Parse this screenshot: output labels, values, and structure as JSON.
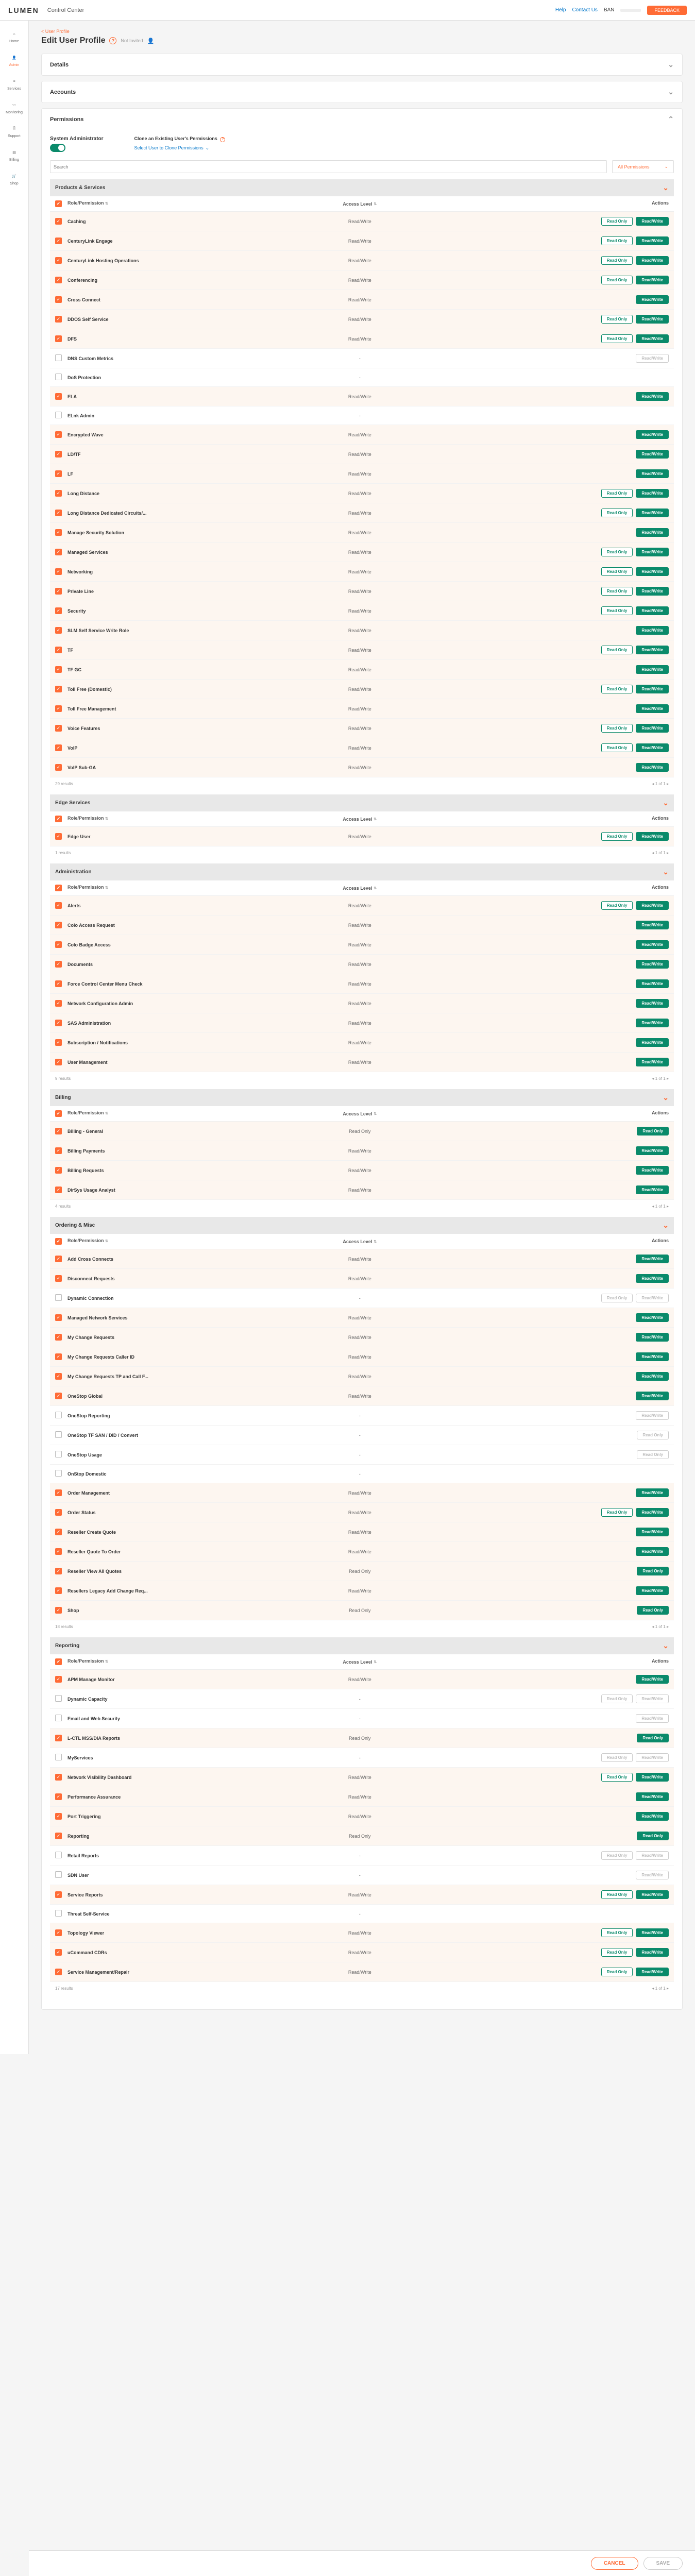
{
  "topbar": {
    "logo": "LUMEN",
    "product": "Control Center",
    "help": "Help",
    "contact": "Contact Us",
    "ban": "BAN",
    "feedback": "FEEDBACK"
  },
  "sidebar": {
    "items": [
      {
        "label": "Home",
        "icon": "⌂"
      },
      {
        "label": "Admin",
        "icon": "👤",
        "active": true
      },
      {
        "label": "Services",
        "icon": "≡"
      },
      {
        "label": "Monitoring",
        "icon": "〰"
      },
      {
        "label": "Support",
        "icon": "🗎"
      },
      {
        "label": "Billing",
        "icon": "▤"
      },
      {
        "label": "Shop",
        "icon": "🛒"
      }
    ]
  },
  "page": {
    "breadcrumb": "< User Profile",
    "title": "Edit User Profile",
    "title_sub": "Not Invited"
  },
  "panels": {
    "details": "Details",
    "accounts": "Accounts",
    "permissions": "Permissions"
  },
  "sysadmin": {
    "label": "System Administrator",
    "clone_title": "Clone an Existing User's Permissions",
    "clone_select": "Select User to Clone Permissions"
  },
  "filters": {
    "search_ph": "Search",
    "perm_sel": "All Permissions"
  },
  "headers": {
    "role": "Role/Permission",
    "level": "Access Level",
    "actions": "Actions"
  },
  "buttons": {
    "ro": "Read Only",
    "rw": "Read/Write",
    "cancel": "CANCEL",
    "save": "SAVE",
    "results": "results",
    "page": "1 of 1"
  },
  "sections": [
    {
      "title": "Products & Services",
      "count": "29 results",
      "rows": [
        {
          "name": "Caching",
          "chk": true,
          "lvl": "Read/Write",
          "ro": true,
          "rw": true,
          "rw_active": true
        },
        {
          "name": "CenturyLink Engage",
          "chk": true,
          "lvl": "Read/Write",
          "ro": true,
          "rw": true,
          "rw_active": true
        },
        {
          "name": "CenturyLink Hosting Operations",
          "chk": true,
          "lvl": "Read/Write",
          "ro": true,
          "rw": true,
          "rw_active": true
        },
        {
          "name": "Conferencing",
          "chk": true,
          "lvl": "Read/Write",
          "ro": true,
          "rw": true,
          "rw_active": true
        },
        {
          "name": "Cross Connect",
          "chk": true,
          "lvl": "Read/Write",
          "rw": true,
          "rw_active": true
        },
        {
          "name": "DDOS Self Service",
          "chk": true,
          "lvl": "Read/Write",
          "ro": true,
          "rw": true,
          "rw_active": true
        },
        {
          "name": "DFS",
          "chk": true,
          "lvl": "Read/Write",
          "ro": true,
          "rw": true,
          "rw_active": true
        },
        {
          "name": "DNS Custom Metrics",
          "chk": false,
          "lvl": "-",
          "rw": true,
          "rw_disabled": true
        },
        {
          "name": "DoS Protection",
          "chk": false,
          "lvl": "-"
        },
        {
          "name": "ELA",
          "chk": true,
          "lvl": "Read/Write",
          "rw": true,
          "rw_active": true
        },
        {
          "name": "ELnk Admin",
          "chk": false,
          "lvl": "-"
        },
        {
          "name": "Encrypted Wave",
          "chk": true,
          "lvl": "Read/Write",
          "rw": true,
          "rw_active": true
        },
        {
          "name": "LD/TF",
          "chk": true,
          "lvl": "Read/Write",
          "rw": true,
          "rw_active": true
        },
        {
          "name": "LF",
          "chk": true,
          "lvl": "Read/Write",
          "rw": true,
          "rw_active": true
        },
        {
          "name": "Long Distance",
          "chk": true,
          "lvl": "Read/Write",
          "ro": true,
          "rw": true,
          "rw_active": true
        },
        {
          "name": "Long Distance Dedicated Circuits/...",
          "chk": true,
          "lvl": "Read/Write",
          "ro": true,
          "rw": true,
          "rw_active": true
        },
        {
          "name": "Manage Security Solution",
          "chk": true,
          "lvl": "Read/Write",
          "rw": true,
          "rw_active": true
        },
        {
          "name": "Managed Services",
          "chk": true,
          "lvl": "Read/Write",
          "ro": true,
          "rw": true,
          "rw_active": true
        },
        {
          "name": "Networking",
          "chk": true,
          "lvl": "Read/Write",
          "ro": true,
          "rw": true,
          "rw_active": true
        },
        {
          "name": "Private Line",
          "chk": true,
          "lvl": "Read/Write",
          "ro": true,
          "rw": true,
          "rw_active": true
        },
        {
          "name": "Security",
          "chk": true,
          "lvl": "Read/Write",
          "ro": true,
          "rw": true,
          "rw_active": true
        },
        {
          "name": "SLM Self Service Write Role",
          "chk": true,
          "lvl": "Read/Write",
          "rw": true,
          "rw_active": true
        },
        {
          "name": "TF",
          "chk": true,
          "lvl": "Read/Write",
          "ro": true,
          "rw": true,
          "rw_active": true
        },
        {
          "name": "TF GC",
          "chk": true,
          "lvl": "Read/Write",
          "rw": true,
          "rw_active": true
        },
        {
          "name": "Toll Free (Domestic)",
          "chk": true,
          "lvl": "Read/Write",
          "ro": true,
          "rw": true,
          "rw_active": true
        },
        {
          "name": "Toll Free Management",
          "chk": true,
          "lvl": "Read/Write",
          "rw": true,
          "rw_active": true
        },
        {
          "name": "Voice Features",
          "chk": true,
          "lvl": "Read/Write",
          "ro": true,
          "rw": true,
          "rw_active": true
        },
        {
          "name": "VoIP",
          "chk": true,
          "lvl": "Read/Write",
          "ro": true,
          "rw": true,
          "rw_active": true
        },
        {
          "name": "VoIP Sub-GA",
          "chk": true,
          "lvl": "Read/Write",
          "rw": true,
          "rw_active": true
        }
      ]
    },
    {
      "title": "Edge Services",
      "count": "1 results",
      "rows": [
        {
          "name": "Edge User",
          "chk": true,
          "lvl": "Read/Write",
          "ro": true,
          "rw": true,
          "rw_active": true
        }
      ]
    },
    {
      "title": "Administration",
      "count": "9 results",
      "rows": [
        {
          "name": "Alerts",
          "chk": true,
          "lvl": "Read/Write",
          "ro": true,
          "rw": true,
          "rw_active": true
        },
        {
          "name": "Colo Access Request",
          "chk": true,
          "lvl": "Read/Write",
          "rw": true,
          "rw_active": true
        },
        {
          "name": "Colo Badge Access",
          "chk": true,
          "lvl": "Read/Write",
          "rw": true,
          "rw_active": true
        },
        {
          "name": "Documents",
          "chk": true,
          "lvl": "Read/Write",
          "rw": true,
          "rw_active": true
        },
        {
          "name": "Force Control Center Menu Check",
          "chk": true,
          "lvl": "Read/Write",
          "rw": true,
          "rw_active": true
        },
        {
          "name": "Network Configuration Admin",
          "chk": true,
          "lvl": "Read/Write",
          "rw": true,
          "rw_active": true
        },
        {
          "name": "SAS Administration",
          "chk": true,
          "lvl": "Read/Write",
          "rw": true,
          "rw_active": true
        },
        {
          "name": "Subscription / Notifications",
          "chk": true,
          "lvl": "Read/Write",
          "rw": true,
          "rw_active": true
        },
        {
          "name": "User Management",
          "chk": true,
          "lvl": "Read/Write",
          "rw": true,
          "rw_active": true
        }
      ]
    },
    {
      "title": "Billing",
      "count": "4 results",
      "rows": [
        {
          "name": "Billing - General",
          "chk": true,
          "lvl": "Read Only",
          "ro": true,
          "ro_active": true
        },
        {
          "name": "Billing Payments",
          "chk": true,
          "lvl": "Read/Write",
          "rw": true,
          "rw_active": true
        },
        {
          "name": "Billing Requests",
          "chk": true,
          "lvl": "Read/Write",
          "rw": true,
          "rw_active": true
        },
        {
          "name": "DirSys Usage Analyst",
          "chk": true,
          "lvl": "Read/Write",
          "rw": true,
          "rw_active": true
        }
      ]
    },
    {
      "title": "Ordering & Misc",
      "count": "18 results",
      "rows": [
        {
          "name": "Add Cross Connects",
          "chk": true,
          "lvl": "Read/Write",
          "rw": true,
          "rw_active": true
        },
        {
          "name": "Disconnect Requests",
          "chk": true,
          "lvl": "Read/Write",
          "rw": true,
          "rw_active": true
        },
        {
          "name": "Dynamic Connection",
          "chk": false,
          "lvl": "-",
          "ro": true,
          "rw": true,
          "both_disabled": true
        },
        {
          "name": "Managed Network Services",
          "chk": true,
          "lvl": "Read/Write",
          "rw": true,
          "rw_active": true
        },
        {
          "name": "My Change Requests",
          "chk": true,
          "lvl": "Read/Write",
          "rw": true,
          "rw_active": true
        },
        {
          "name": "My Change Requests Caller ID",
          "chk": true,
          "lvl": "Read/Write",
          "rw": true,
          "rw_active": true
        },
        {
          "name": "My Change Requests TP and Call F...",
          "chk": true,
          "lvl": "Read/Write",
          "rw": true,
          "rw_active": true
        },
        {
          "name": "OneStop Global",
          "chk": true,
          "lvl": "Read/Write",
          "rw": true,
          "rw_active": true
        },
        {
          "name": "OneStop Reporting",
          "chk": false,
          "lvl": "-",
          "rw": true,
          "rw_disabled": true
        },
        {
          "name": "OneStop TF SAN / DID / Convert",
          "chk": false,
          "lvl": "-",
          "ro": true,
          "ro_disabled": true
        },
        {
          "name": "OneStop Usage",
          "chk": false,
          "lvl": "-",
          "ro": true,
          "ro_disabled": true
        },
        {
          "name": "OnStop Domestic",
          "chk": false,
          "lvl": "-"
        },
        {
          "name": "Order Management",
          "chk": true,
          "lvl": "Read/Write",
          "rw": true,
          "rw_active": true
        },
        {
          "name": "Order Status",
          "chk": true,
          "lvl": "Read/Write",
          "ro": true,
          "rw": true,
          "rw_active": true
        },
        {
          "name": "Reseller Create Quote",
          "chk": true,
          "lvl": "Read/Write",
          "rw": true,
          "rw_active": true
        },
        {
          "name": "Reseller Quote To Order",
          "chk": true,
          "lvl": "Read/Write",
          "rw": true,
          "rw_active": true
        },
        {
          "name": "Reseller View All Quotes",
          "chk": true,
          "lvl": "Read Only",
          "ro": true,
          "ro_active": true
        },
        {
          "name": "Resellers Legacy Add Change Req...",
          "chk": true,
          "lvl": "Read/Write",
          "rw": true,
          "rw_active": true
        },
        {
          "name": "Shop",
          "chk": true,
          "lvl": "Read Only",
          "ro": true,
          "ro_active": true
        }
      ]
    },
    {
      "title": "Reporting",
      "count": "17 results",
      "rows": [
        {
          "name": "APM Manage Monitor",
          "chk": true,
          "lvl": "Read/Write",
          "rw": true,
          "rw_active": true
        },
        {
          "name": "Dynamic Capacity",
          "chk": false,
          "lvl": "-",
          "ro": true,
          "rw": true,
          "both_disabled": true
        },
        {
          "name": "Email and Web Security",
          "chk": false,
          "lvl": "-",
          "rw": true,
          "rw_disabled": true
        },
        {
          "name": "L-CTL MSS/DIA Reports",
          "chk": true,
          "lvl": "Read Only",
          "ro": true,
          "ro_active": true
        },
        {
          "name": "MyServices",
          "chk": false,
          "lvl": "-",
          "ro": true,
          "rw": true,
          "both_disabled": true
        },
        {
          "name": "Network Visibility Dashboard",
          "chk": true,
          "lvl": "Read/Write",
          "ro": true,
          "rw": true,
          "rw_active": true
        },
        {
          "name": "Performance Assurance",
          "chk": true,
          "lvl": "Read/Write",
          "rw": true,
          "rw_active": true
        },
        {
          "name": "Port Triggering",
          "chk": true,
          "lvl": "Read/Write",
          "rw": true,
          "rw_active": true
        },
        {
          "name": "Reporting",
          "chk": true,
          "lvl": "Read Only",
          "ro": true,
          "ro_active": true
        },
        {
          "name": "Retail Reports",
          "chk": false,
          "lvl": "-",
          "ro": true,
          "rw": true,
          "both_disabled": true
        },
        {
          "name": "SDN User",
          "chk": false,
          "lvl": "-",
          "rw": true,
          "rw_disabled": true
        },
        {
          "name": "Service Reports",
          "chk": true,
          "lvl": "Read/Write",
          "ro": true,
          "rw": true,
          "rw_active": true
        },
        {
          "name": "Threat Self-Service",
          "chk": false,
          "lvl": "-"
        },
        {
          "name": "Topology Viewer",
          "chk": true,
          "lvl": "Read/Write",
          "ro": true,
          "rw": true,
          "rw_active": true
        },
        {
          "name": "uCommand CDRs",
          "chk": true,
          "lvl": "Read/Write",
          "ro": true,
          "rw": true,
          "rw_active": true
        },
        {
          "name": "Service Management/Repair",
          "chk": true,
          "lvl": "Read/Write",
          "ro": true,
          "rw": true,
          "rw_active": true
        }
      ]
    }
  ]
}
